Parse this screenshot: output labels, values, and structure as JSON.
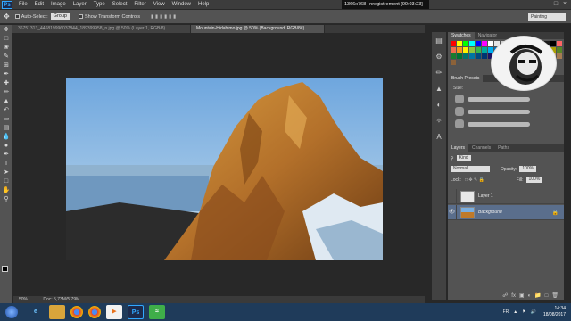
{
  "app": {
    "logo": "Ps"
  },
  "menubar": {
    "items": [
      "File",
      "Edit",
      "Image",
      "Layer",
      "Type",
      "Select",
      "Filter",
      "View",
      "Window",
      "Help"
    ],
    "recorder": {
      "resolution": "1366x768",
      "status": "nregistrement [00:03:23]"
    }
  },
  "options": {
    "auto_select_label": "Auto-Select:",
    "auto_select_value": "Group",
    "transform_label": "Show Transform Controls",
    "workspace": "Painting"
  },
  "tabs": [
    {
      "label": "36751313_446819996037844_189399958_n.jpg @ 50% (Layer 1, RGB/8)",
      "active": false
    },
    {
      "label": "Mountain-Hidahimo.jpg @ 50% (Background, RGB/8#)",
      "active": true
    }
  ],
  "status": {
    "zoom": "50%",
    "doc": "Doc: 5,73M/5,79M"
  },
  "panels": {
    "swatches_tab": "Swatches",
    "navigator_tab": "Navigator",
    "brush_presets_title": "Brush Presets",
    "size_label": "Size:",
    "layers_tab": "Layers",
    "channels_tab": "Channels",
    "paths_tab": "Paths",
    "kind_label": "Kind",
    "blend_mode": "Normal",
    "opacity_label": "Opacity:",
    "opacity_value": "100%",
    "lock_label": "Lock:",
    "fill_label": "Fill:",
    "fill_value": "100%",
    "layers": [
      {
        "name": "Layer 1",
        "selected": false
      },
      {
        "name": "Background",
        "selected": true
      }
    ]
  },
  "taskbar": {
    "lang": "FR",
    "time": "14:34",
    "date": "18/08/2017"
  },
  "colors": {
    "ps_blue": "#31a8ff",
    "sky_top": "#7aaee0",
    "mountain": "#c07a2a",
    "selected_layer": "#5a6e8c"
  },
  "icons": {
    "tools": [
      "move-icon",
      "marquee-icon",
      "lasso-icon",
      "quick-select-icon",
      "crop-icon",
      "eyedropper-icon",
      "healing-icon",
      "brush-icon",
      "clone-stamp-icon",
      "history-brush-icon",
      "eraser-icon",
      "gradient-icon",
      "blur-icon",
      "dodge-icon",
      "pen-icon",
      "type-icon",
      "path-select-icon",
      "shape-icon",
      "hand-icon",
      "zoom-icon"
    ]
  }
}
